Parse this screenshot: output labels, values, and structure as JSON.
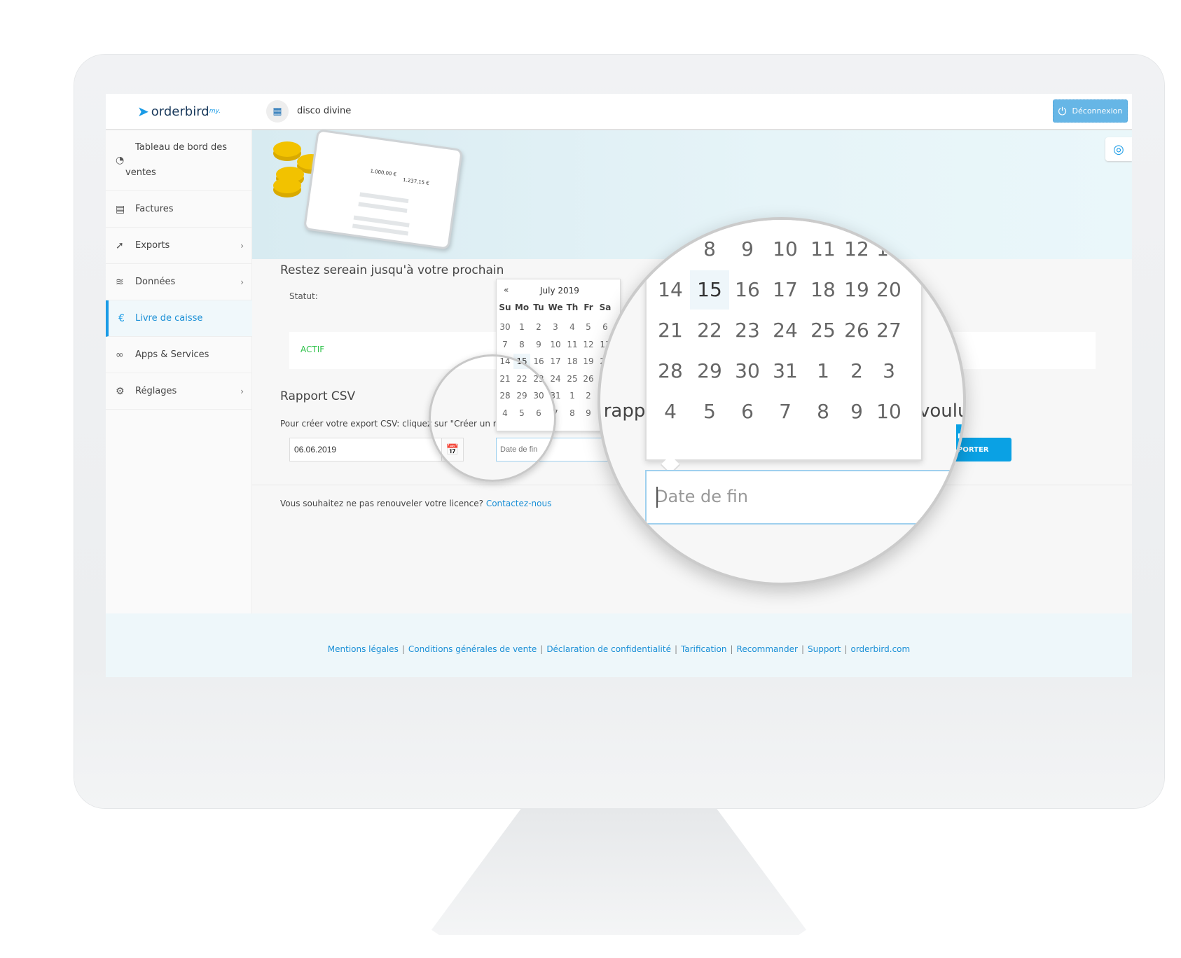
{
  "brand": {
    "logo_text": "orderbird",
    "logo_sup": "my."
  },
  "header": {
    "shop_name": "disco divine",
    "logout_label": "Déconnexion",
    "logout_icon": "power-icon",
    "help_icon": "lifebuoy-icon"
  },
  "sidebar": {
    "items": [
      {
        "label": "Tableau de bord des ventes",
        "icon": "gauge-icon",
        "chevron": false
      },
      {
        "label": "Factures",
        "icon": "receipt-icon",
        "chevron": false
      },
      {
        "label": "Exports",
        "icon": "export-icon",
        "chevron": true
      },
      {
        "label": "Données",
        "icon": "layers-icon",
        "chevron": true
      },
      {
        "label": "Livre de caisse",
        "icon": "cashbook-icon",
        "chevron": false,
        "active": true
      },
      {
        "label": "Apps & Services",
        "icon": "rings-icon",
        "chevron": false
      },
      {
        "label": "Réglages",
        "icon": "gear-icon",
        "chevron": true
      }
    ]
  },
  "banner": {
    "tablet_amount_1": "1.000,00 €",
    "tablet_amount_2": "1.237,15 €"
  },
  "main": {
    "title": "Restez sereain jusqu'à votre prochain",
    "status_label": "Statut:",
    "status_value": "ACTIF",
    "csv_title": "Rapport CSV",
    "csv_text": "Pour créer votre export CSV: cliquez sur \"Créer un rapp",
    "start_date": "06.06.2019",
    "end_date_placeholder": "Date de fin",
    "export_label": "EXPORTER",
    "renew_text": "Vous souhaitez ne pas renouveler votre licence?",
    "renew_link": "Contactez-nous"
  },
  "datepicker": {
    "prev": "«",
    "month": "July 2019",
    "weekdays": [
      "Su",
      "Mo",
      "Tu",
      "We",
      "Th",
      "Fr",
      "Sa"
    ],
    "weeks": [
      [
        30,
        1,
        2,
        3,
        4,
        5,
        6
      ],
      [
        7,
        8,
        9,
        10,
        11,
        12,
        13
      ],
      [
        14,
        15,
        16,
        17,
        18,
        19,
        20
      ],
      [
        21,
        22,
        23,
        24,
        25,
        26,
        27
      ],
      [
        28,
        29,
        30,
        31,
        1,
        2,
        3
      ],
      [
        4,
        5,
        6,
        7,
        8,
        9,
        10
      ]
    ],
    "today": 15
  },
  "magnifier": {
    "text_left": "n rapp",
    "text_right": "voulu",
    "button_fragment": "RTER"
  },
  "footer": {
    "links": [
      "Mentions légales",
      "Conditions générales de vente",
      "Déclaration de confidentialité",
      "Tarification",
      "Recommander",
      "Support",
      "orderbird.com"
    ]
  },
  "colors": {
    "accent": "#1a9be6",
    "active": "#2ec24a",
    "button": "#0aa1e4",
    "logout": "#66b6e6"
  }
}
